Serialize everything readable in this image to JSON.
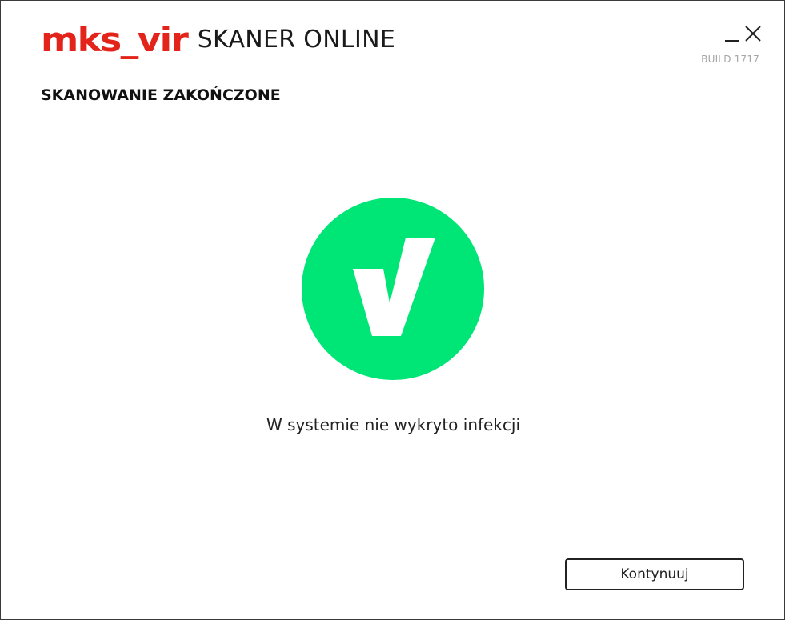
{
  "header": {
    "brand": "mks_vir",
    "product": "SKANER ONLINE",
    "build": "BUILD 1717",
    "brand_color": "#e3241b"
  },
  "window_controls": {
    "minimize_icon": "minimize-icon",
    "close_icon": "close-icon"
  },
  "main": {
    "title": "SKANOWANIE ZAKOŃCZONE",
    "status_icon": "checkmark-icon",
    "status_color": "#00e676",
    "message": "W systemie nie wykryto infekcji"
  },
  "footer": {
    "continue_label": "Kontynuuj"
  }
}
